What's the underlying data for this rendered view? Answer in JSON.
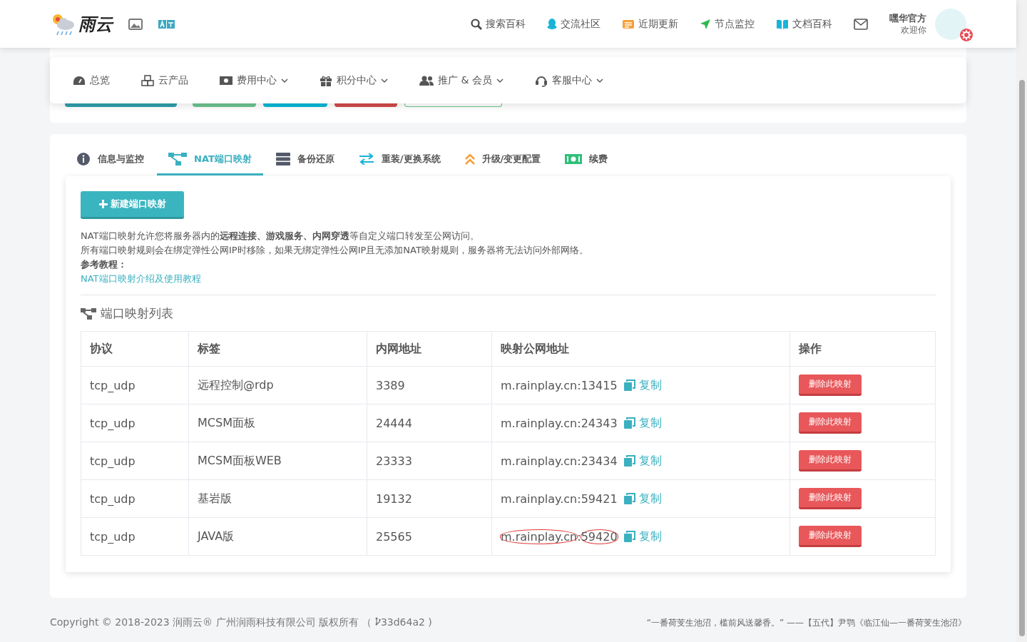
{
  "header": {
    "logo_text": "雨云",
    "nav": [
      {
        "label": "搜索百科"
      },
      {
        "label": "交流社区"
      },
      {
        "label": "近期更新"
      },
      {
        "label": "节点监控"
      },
      {
        "label": "文档百科"
      }
    ],
    "user": {
      "name": "嘿华官方",
      "greeting": "欢迎你"
    }
  },
  "menu": [
    {
      "label": "总览",
      "dropdown": false
    },
    {
      "label": "云产品",
      "dropdown": false
    },
    {
      "label": "费用中心",
      "dropdown": true
    },
    {
      "label": "积分中心",
      "dropdown": true
    },
    {
      "label": "推广 & 会员",
      "dropdown": true
    },
    {
      "label": "客服中心",
      "dropdown": true
    }
  ],
  "tabs": [
    {
      "label": "信息与监控",
      "selected": false
    },
    {
      "label": "NAT端口映射",
      "selected": true
    },
    {
      "label": "备份还原",
      "selected": false
    },
    {
      "label": "重装/更换系统",
      "selected": false
    },
    {
      "label": "升级/变更配置",
      "selected": false
    },
    {
      "label": "续费",
      "selected": false
    }
  ],
  "new_button": "新建端口映射",
  "intro": [
    "NAT端口映射允许您将服务器内的**远程连接、游戏服务、内网穿透**等自定义端口转发至公网访问。",
    "所有端口映射规则会在绑定弹性公网IP时移除，如果无绑定弹性公网IP且无添加NAT映射规则，服务器将无法访问外部网络。",
    "**参考教程：**"
  ],
  "tutorial_link": "NAT端口映射介绍及使用教程",
  "list_title": "端口映射列表",
  "table": {
    "columns": [
      "协议",
      "标签",
      "内网地址",
      "映射公网地址",
      "操作"
    ],
    "rows": [
      {
        "protocol": "tcp_udp",
        "label": "远程控制@rdp",
        "internal": "3389",
        "host": "m.rainplay.cn",
        "separator": ":",
        "port": "13415",
        "copy": "复制",
        "action": "删除此映射",
        "annotated": false
      },
      {
        "protocol": "tcp_udp",
        "label": "MCSM面板",
        "internal": "24444",
        "host": "m.rainplay.cn",
        "separator": ":",
        "port": "24343",
        "copy": "复制",
        "action": "删除此映射",
        "annotated": false
      },
      {
        "protocol": "tcp_udp",
        "label": "MCSM面板WEB",
        "internal": "23333",
        "host": "m.rainplay.cn",
        "separator": ":",
        "port": "23434",
        "copy": "复制",
        "action": "删除此映射",
        "annotated": false
      },
      {
        "protocol": "tcp_udp",
        "label": "基岩版",
        "internal": "19132",
        "host": "m.rainplay.cn",
        "separator": ":",
        "port": "59421",
        "copy": "复制",
        "action": "删除此映射",
        "annotated": false
      },
      {
        "protocol": "tcp_udp",
        "label": "JAVA版",
        "internal": "25565",
        "host": "m.rainplay.cn",
        "separator": ":",
        "port": "59420",
        "copy": "复制",
        "action": "删除此映射",
        "annotated": true
      }
    ]
  },
  "footer": {
    "copyright": "Copyright © 2018-2023 润雨云® 广州润雨科技有限公司 版权所有 （",
    "commit": "33d64a2 )",
    "quote": "“一番荷芰生池沼，槛前风送馨香。” ——【五代】尹鹗《临江仙—一番荷芰生池沼》"
  }
}
